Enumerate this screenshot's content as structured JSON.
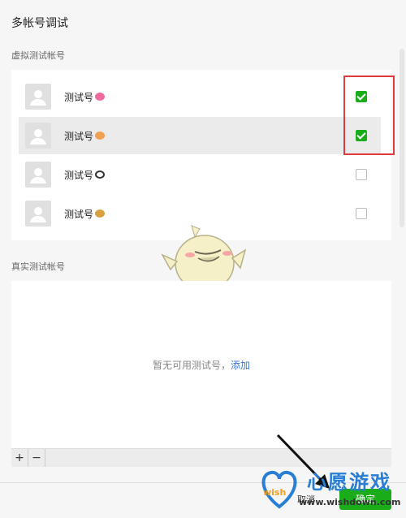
{
  "dialog": {
    "title": "多帐号调试"
  },
  "virtual_section": {
    "label": "虚拟测试帐号",
    "accounts": [
      {
        "name": "测试号",
        "emoji_icon": "pig-emoji-icon",
        "emoji_color": "#f06aa0",
        "checked": true
      },
      {
        "name": "测试号",
        "emoji_icon": "fist-emoji-icon",
        "emoji_color": "#f0a050",
        "checked": true
      },
      {
        "name": "测试号",
        "emoji_icon": "panda-emoji-icon",
        "emoji_color": "#333333",
        "checked": false
      },
      {
        "name": "测试号",
        "emoji_icon": "cat-emoji-icon",
        "emoji_color": "#d8a040",
        "checked": false
      }
    ]
  },
  "real_section": {
    "label": "真实测试帐号",
    "empty_text": "暂无可用测试号，",
    "add_link": "添加"
  },
  "toolbar": {
    "add": "+",
    "remove": "−"
  },
  "footer": {
    "cancel": "取消",
    "confirm": "确定"
  },
  "watermark": {
    "brand": "心愿游戏",
    "url": "www.wishdown.com",
    "logo_text": "wish"
  },
  "colors": {
    "accent": "#1aad19",
    "link": "#3d76c5",
    "highlight": "#e23a3a"
  }
}
